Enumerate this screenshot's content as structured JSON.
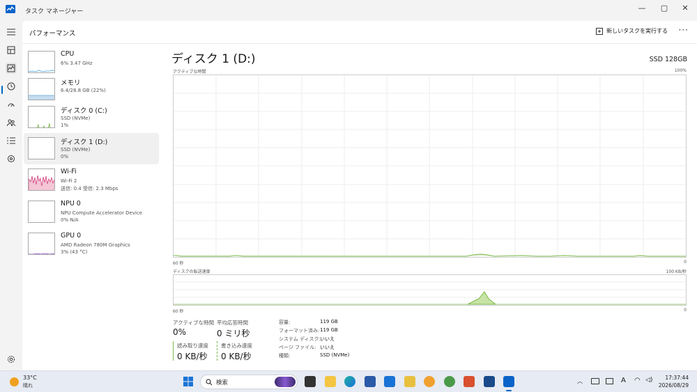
{
  "window": {
    "title": "タスク マネージャー",
    "minimize": "—",
    "maximize": "▢",
    "close": "✕"
  },
  "header": {
    "page_title": "パフォーマンス",
    "run_task_label": "新しいタスクを実行する",
    "more": "···"
  },
  "devices": [
    {
      "name": "CPU",
      "sub1": "6% 3.47 GHz",
      "sub2": ""
    },
    {
      "name": "メモリ",
      "sub1": "6.4/28.8 GB (22%)",
      "sub2": ""
    },
    {
      "name": "ディスク 0 (C:)",
      "sub1": "SSD (NVMe)",
      "sub2": "1%"
    },
    {
      "name": "ディスク 1 (D:)",
      "sub1": "SSD (NVMe)",
      "sub2": "0%"
    },
    {
      "name": "Wi-Fi",
      "sub1": "Wi-Fi 2",
      "sub2": "送信: 0.4 受信: 2.3 Mbps"
    },
    {
      "name": "NPU 0",
      "sub1": "NPU Compute Accelerator Device",
      "sub2": "0% N/A"
    },
    {
      "name": "GPU 0",
      "sub1": "AMD Radeon 780M Graphics",
      "sub2": "3% (43 °C)"
    }
  ],
  "detail": {
    "title": "ディスク 1 (D:)",
    "model": "SSD 128GB",
    "graph1": {
      "label": "アクティブな時間",
      "max": "100%",
      "left": "60 秒",
      "right": "0"
    },
    "graph2": {
      "label": "ディスクの転送速度",
      "max": "100 KB/秒",
      "left": "60 秒",
      "right": "0"
    },
    "stats": {
      "active_label": "アクティブな時間",
      "active_value": "0%",
      "resp_label": "平均応答時間",
      "resp_value": "0 ミリ秒",
      "read_label": "読み取り速度",
      "read_value": "0 KB/秒",
      "write_label": "書き込み速度",
      "write_value": "0 KB/秒"
    },
    "props": [
      {
        "k": "容量:",
        "v": "119 GB"
      },
      {
        "k": "フォーマット済み:",
        "v": "119 GB"
      },
      {
        "k": "システム ディスク:",
        "v": "いいえ"
      },
      {
        "k": "ページ ファイル:",
        "v": "いいえ"
      },
      {
        "k": "種類:",
        "v": "SSD (NVMe)"
      }
    ]
  },
  "taskbar": {
    "temp": "33°C",
    "condition": "晴れ",
    "search": "検索",
    "time": "17:37:44",
    "date": "2026/08/29",
    "ime": "A"
  },
  "colors": {
    "accent": "#0067c0",
    "disk_green": "#7ab948",
    "wifi_pink": "#d03070"
  }
}
